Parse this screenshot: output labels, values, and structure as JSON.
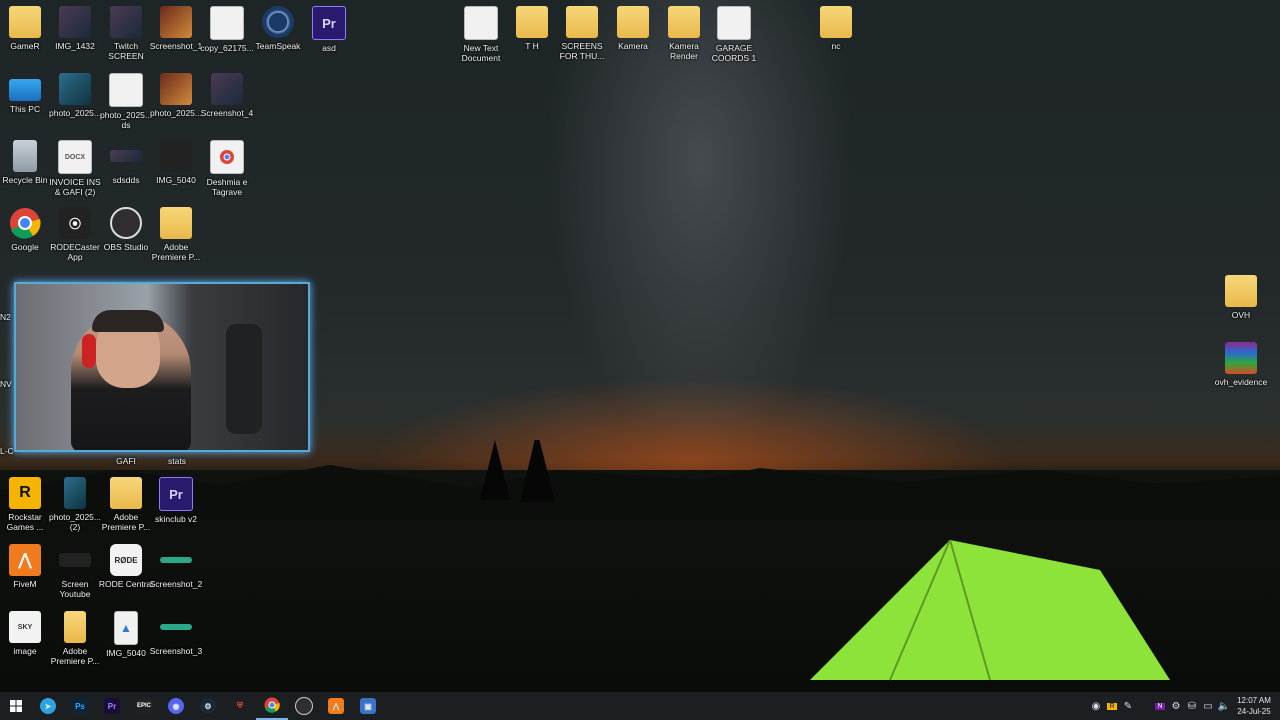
{
  "desktop": {
    "icons": [
      {
        "label": "GameR",
        "icon": "folder-icon"
      },
      {
        "label": "IMG_1432",
        "icon": "image-thumb-icon"
      },
      {
        "label": "Twitch SCREEN",
        "icon": "image-thumb-icon"
      },
      {
        "label": "Screenshot_1",
        "icon": "image-thumb-icon"
      },
      {
        "label": "copy_62175...",
        "icon": "video-file-icon"
      },
      {
        "label": "TeamSpeak",
        "icon": "teamspeak-icon"
      },
      {
        "label": "asd",
        "icon": "premiere-project-icon"
      },
      {
        "label": "New Text Document",
        "icon": "text-file-icon"
      },
      {
        "label": "T H",
        "icon": "folder-icon"
      },
      {
        "label": "SCREENS FOR THU...",
        "icon": "folder-icon"
      },
      {
        "label": "Kamera",
        "icon": "folder-icon"
      },
      {
        "label": "Kamera Render",
        "icon": "folder-icon"
      },
      {
        "label": "GARAGE COORDS 1",
        "icon": "text-file-icon"
      },
      {
        "label": "nc",
        "icon": "folder-icon"
      },
      {
        "label": "This PC",
        "icon": "this-pc-icon"
      },
      {
        "label": "photo_2025...",
        "icon": "image-thumb-icon"
      },
      {
        "label": "photo_2025... ds",
        "icon": "image-thumb-icon"
      },
      {
        "label": "photo_2025...",
        "icon": "image-thumb-icon"
      },
      {
        "label": "Screenshot_4",
        "icon": "image-thumb-icon"
      },
      {
        "label": "Recycle Bin",
        "icon": "recycle-bin-icon"
      },
      {
        "label": "INVOICE INS & GAFI (2)",
        "icon": "docx-file-icon"
      },
      {
        "label": "sdsdds",
        "icon": "image-thumb-icon"
      },
      {
        "label": "IMG_5040",
        "icon": "image-thumb-icon"
      },
      {
        "label": "Deshmia e Tagrave",
        "icon": "chrome-file-icon"
      },
      {
        "label": "Google",
        "icon": "chrome-icon"
      },
      {
        "label": "RODECaster App",
        "icon": "rodecaster-icon"
      },
      {
        "label": "OBS Studio",
        "icon": "obs-icon"
      },
      {
        "label": "Adobe Premiere P...",
        "icon": "folder-icon"
      },
      {
        "label": "OVH",
        "icon": "folder-icon"
      },
      {
        "label": "ovh_evidence",
        "icon": "winrar-archive-icon"
      },
      {
        "label": "GAFI",
        "icon": "partially-hidden-icon"
      },
      {
        "label": "stats",
        "icon": "partially-hidden-icon"
      },
      {
        "label": "Rockstar Games ...",
        "icon": "rockstar-icon"
      },
      {
        "label": "photo_2025... (2)",
        "icon": "image-thumb-icon"
      },
      {
        "label": "Adobe Premiere P...",
        "icon": "folder-icon"
      },
      {
        "label": "skinclub v2",
        "icon": "premiere-project-icon"
      },
      {
        "label": "FiveM",
        "icon": "fivem-icon"
      },
      {
        "label": "Screen Youtube",
        "icon": "image-thumb-icon"
      },
      {
        "label": "RODE Central",
        "icon": "rode-central-icon"
      },
      {
        "label": "Screenshot_2",
        "icon": "image-thumb-icon"
      },
      {
        "label": "image",
        "icon": "image-file-icon"
      },
      {
        "label": "Adobe Premiere P...",
        "icon": "premiere-folder-icon"
      },
      {
        "label": "IMG_5040",
        "icon": "image-file-icon"
      },
      {
        "label": "Screenshot_3",
        "icon": "image-thumb-icon"
      }
    ],
    "hidden_labels": [
      "N2",
      "NV",
      "L-C"
    ]
  },
  "taskbar": {
    "apps": [
      "start-icon",
      "telegram-icon",
      "photoshop-icon",
      "premiere-icon",
      "epic-games-icon",
      "discord-icon",
      "steam-icon",
      "shield-icon",
      "chrome-icon",
      "obs-icon",
      "fivem-icon",
      "explorer-icon"
    ],
    "app_text": {
      "photoshop": "Ps",
      "premiere": "Pr",
      "epic": "EPIC"
    },
    "tray_text": {
      "onenote": "N"
    },
    "clock_time": "12:07 AM",
    "clock_date": "24-Jul-25"
  },
  "colors": {
    "taskbar": "#1b1f22",
    "accent": "#7fb3e6",
    "webcam_border": "#59a9d8",
    "tent": "#8ee33a"
  }
}
